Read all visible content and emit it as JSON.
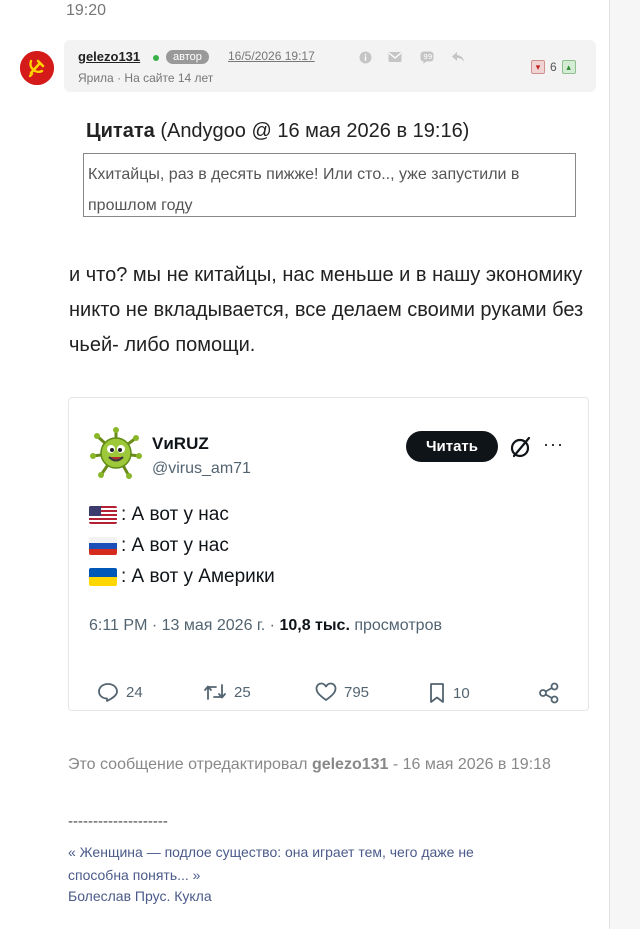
{
  "top_time": "19:20",
  "post": {
    "username": "gelezo131",
    "author_badge": "автор",
    "timestamp": "16/5/2026 19:17",
    "location": "Ярила",
    "tenure": "На сайте 14 лет",
    "rating_count": "6"
  },
  "quote": {
    "label": "Цитата",
    "attribution": "(Andygoo @ 16 мая 2026 в 19:16)",
    "text": "Кхитайцы, раз в десять пижже! Или сто.., уже запустили в прошлом году"
  },
  "message": "и что? мы не китайцы, нас меньше и в нашу экономику никто не вкладывается, все делаем своими руками без чьей- либо помощи.",
  "tweet": {
    "name": "VиRUZ",
    "handle": "@virus_am71",
    "follow_label": "Читать",
    "more": "···",
    "lines": [
      {
        "flag": "us",
        "text": ": А вот у нас"
      },
      {
        "flag": "ru",
        "text": ": А вот у нас"
      },
      {
        "flag": "ua",
        "text": ": А вот у Америки"
      }
    ],
    "meta_time": "6:11 PM · 13 мая 2026 г. · ",
    "meta_views": "10,8 тыс.",
    "meta_views_label": " просмотров",
    "replies": "24",
    "retweets": "25",
    "likes": "795",
    "bookmarks": "10"
  },
  "edit_note": {
    "prefix": "Это сообщение отредактировал ",
    "user": "gelezo131",
    "suffix": " - 16 мая 2026 в 19:18"
  },
  "signature": {
    "separator": "--------------------",
    "quote": "« Женщина — подлое существо: она играет тем, чего даже не способна понять... »",
    "author": "Болеслав Прус. Кукла"
  },
  "colors": {
    "avatar_red": "#d51a1a",
    "online_green": "#38b04a",
    "signature_blue": "#4a5a8a"
  }
}
